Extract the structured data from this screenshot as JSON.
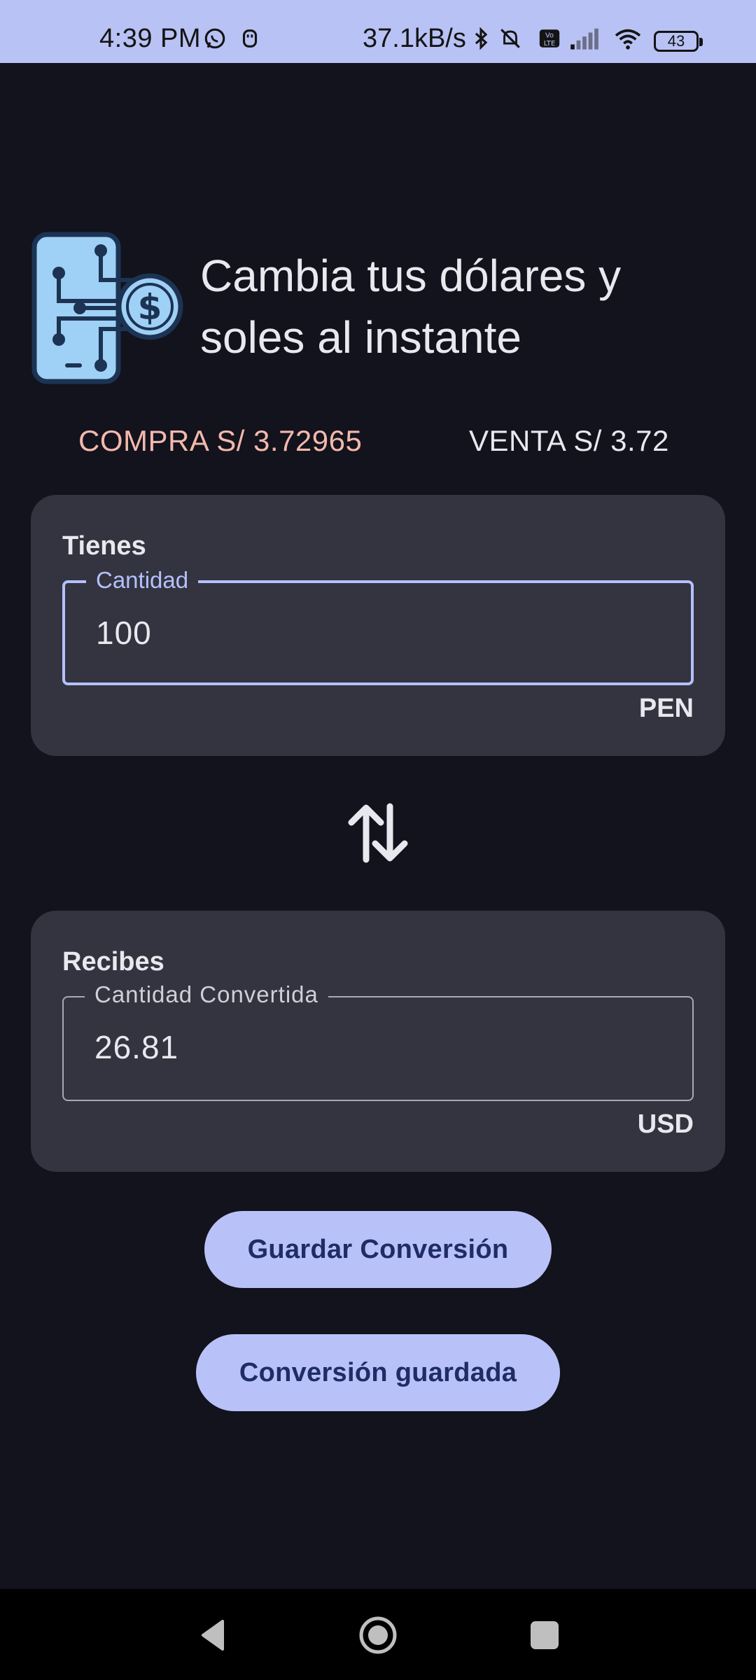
{
  "status_bar": {
    "time": "4:39 PM",
    "network_speed": "37.1kB/s",
    "battery": "43",
    "icons": [
      "whatsapp-icon",
      "usb-icon",
      "bluetooth-icon",
      "mute-icon",
      "volte-icon",
      "signal-icon",
      "wifi-icon",
      "battery-icon"
    ]
  },
  "header": {
    "logo_icon": "digital-dollar-phone-icon",
    "title": "Cambia tus dólares y soles al instante"
  },
  "rates": {
    "buy": "COMPRA S/ 3.72965",
    "sell": "VENTA S/ 3.72"
  },
  "have_card": {
    "title": "Tienes",
    "field_label": "Cantidad",
    "field_value": "100",
    "currency": "PEN"
  },
  "swap_icon": "swap-vertical-icon",
  "get_card": {
    "title": "Recibes",
    "field_label": "Cantidad Convertida",
    "field_value": "26.81",
    "currency": "USD"
  },
  "buttons": {
    "save": "Guardar Conversión",
    "saved": "Conversión guardada"
  },
  "colors": {
    "background": "#12131c",
    "card": "#33343f",
    "accent": "#b9c2f8",
    "buy_rate": "#f4b8ad",
    "status_bar": "#b9c2f4"
  }
}
